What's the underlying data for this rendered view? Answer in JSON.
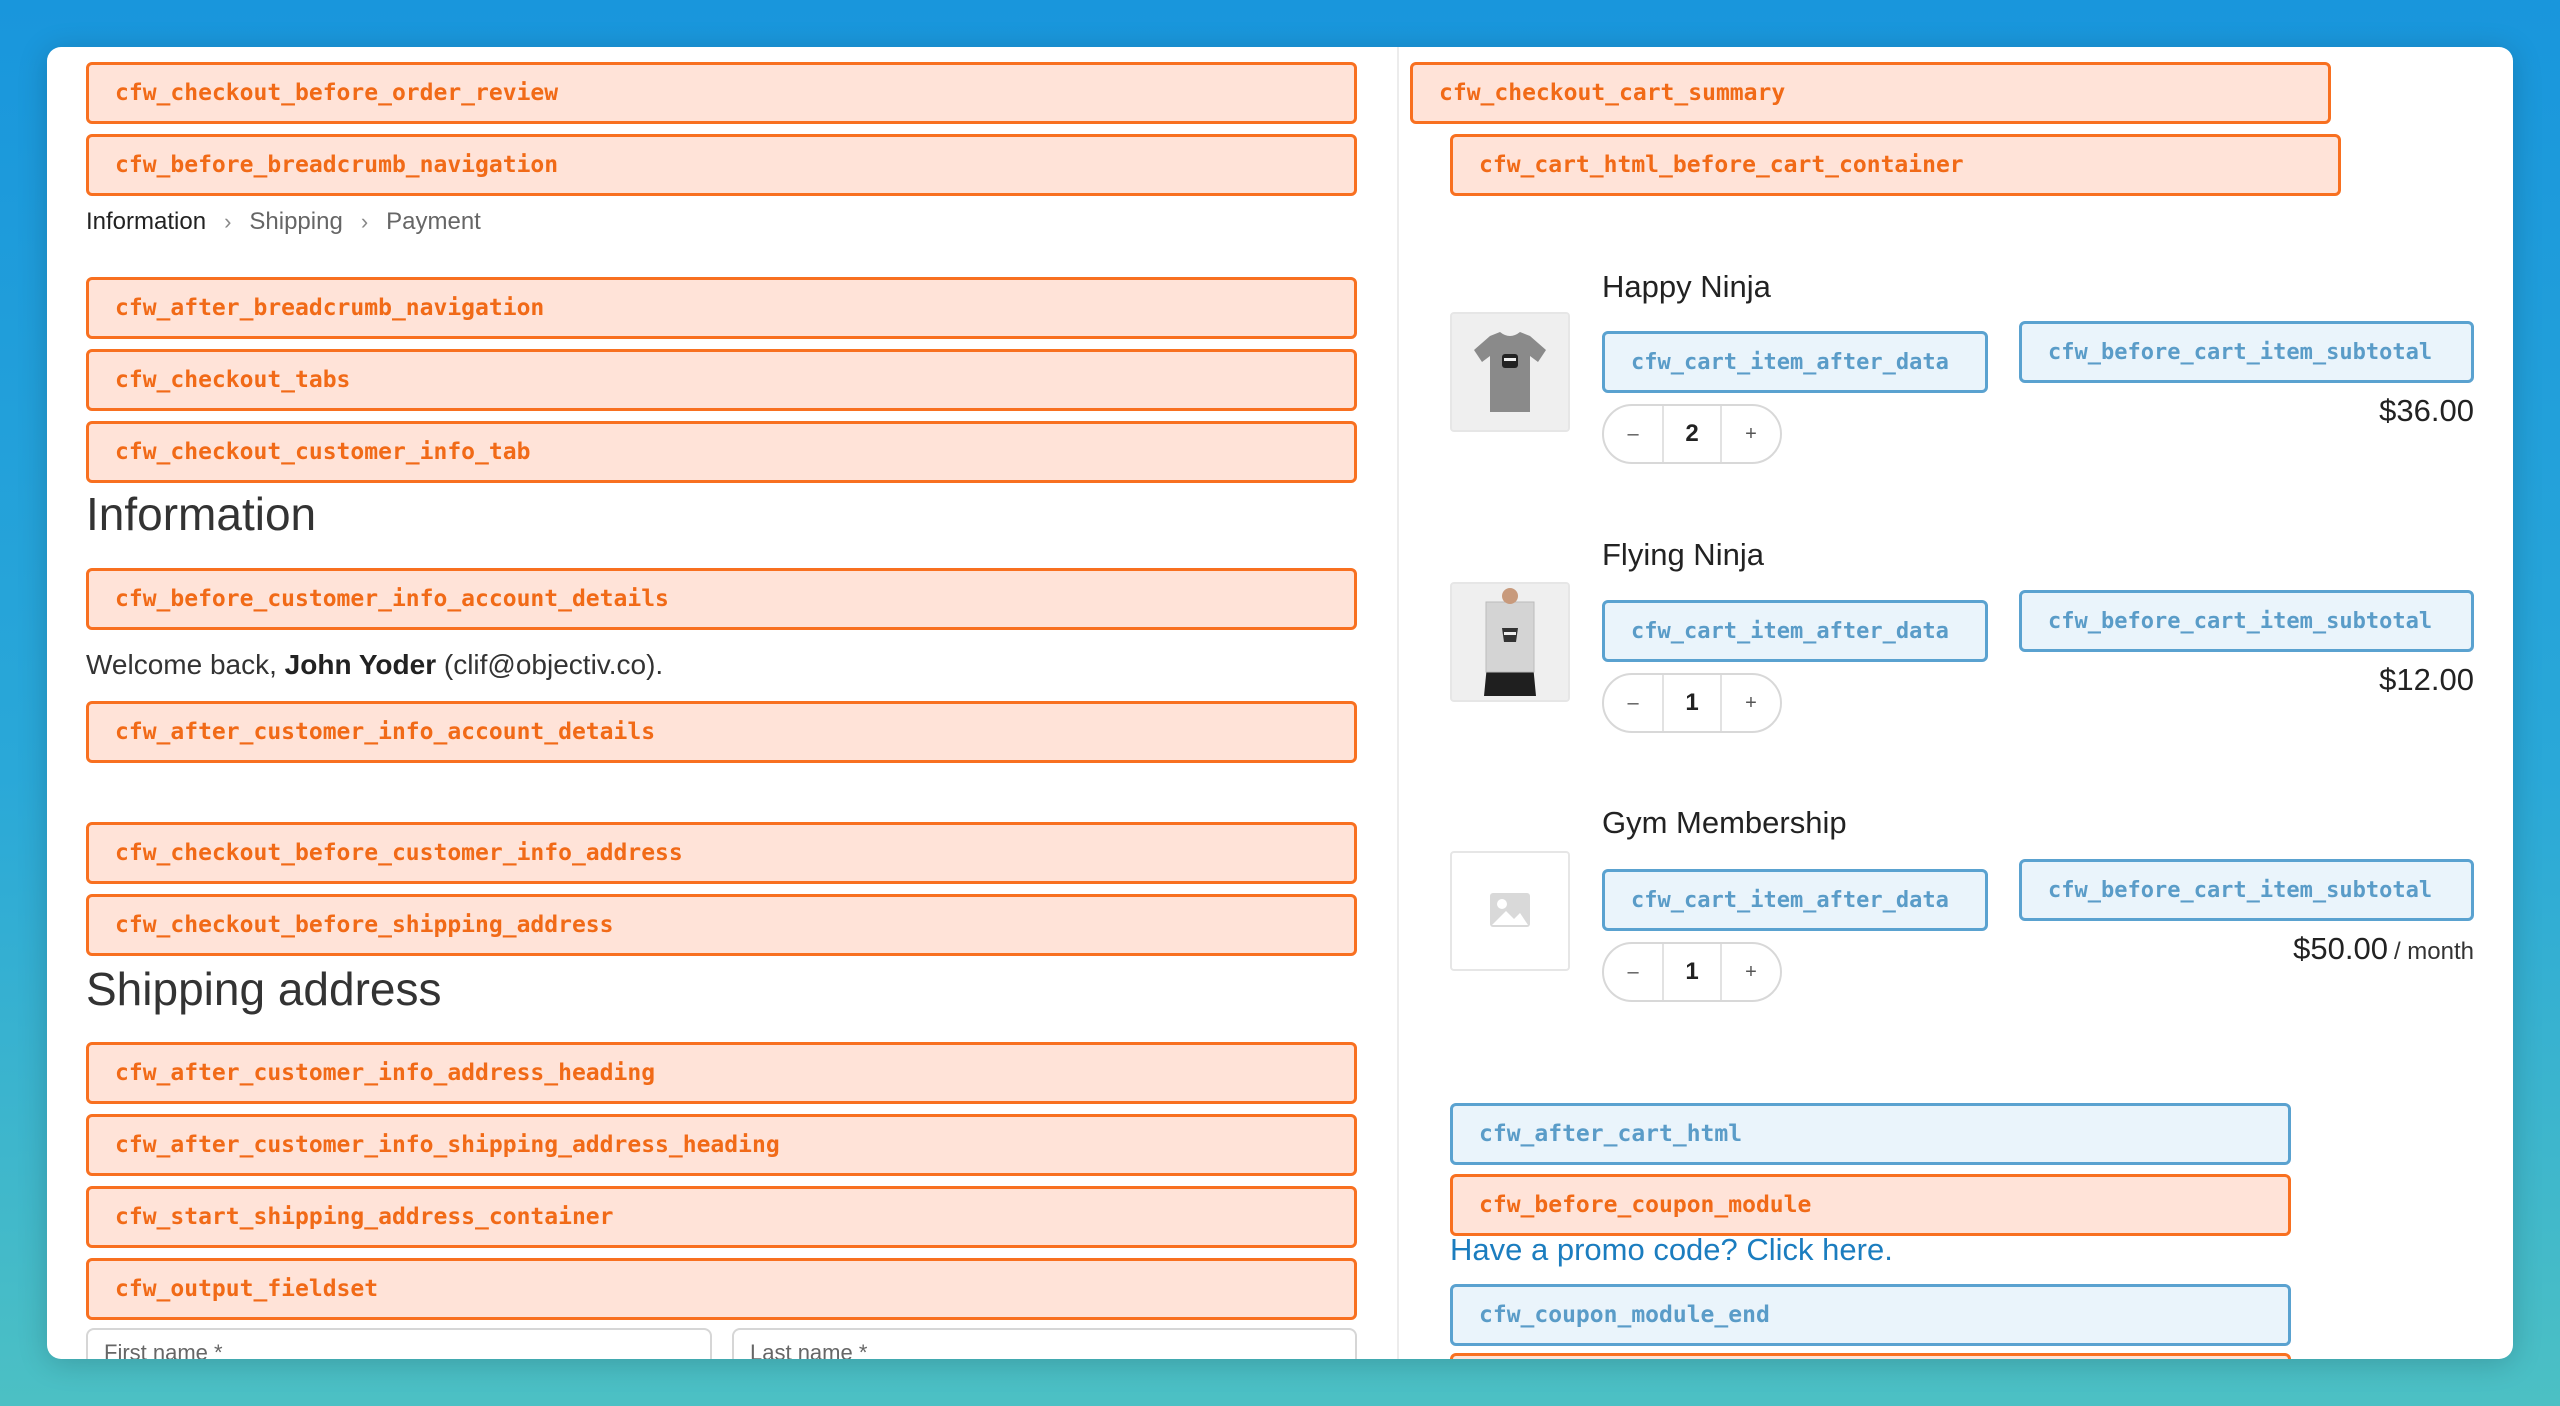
{
  "left_hooks": {
    "before_order_review": "cfw_checkout_before_order_review",
    "before_breadcrumb": "cfw_before_breadcrumb_navigation",
    "after_breadcrumb": "cfw_after_breadcrumb_navigation",
    "checkout_tabs": "cfw_checkout_tabs",
    "customer_info_tab": "cfw_checkout_customer_info_tab",
    "before_account_details": "cfw_before_customer_info_account_details",
    "after_account_details": "cfw_after_customer_info_account_details",
    "before_customer_info_address": "cfw_checkout_before_customer_info_address",
    "before_shipping_address": "cfw_checkout_before_shipping_address",
    "after_address_heading": "cfw_after_customer_info_address_heading",
    "after_shipping_address_heading": "cfw_after_customer_info_shipping_address_heading",
    "start_shipping_container": "cfw_start_shipping_address_container",
    "output_fieldset": "cfw_output_fieldset"
  },
  "breadcrumb": {
    "step1": "Information",
    "step2": "Shipping",
    "step3": "Payment",
    "separator": "›"
  },
  "headings": {
    "information": "Information",
    "shipping_address": "Shipping address"
  },
  "welcome": {
    "prefix": "Welcome back, ",
    "name": "John Yoder",
    "email": " (clif@objectiv.co)."
  },
  "fields": {
    "first_name": "First name *",
    "last_name": "Last name *"
  },
  "right_hooks": {
    "cart_summary": "cfw_checkout_cart_summary",
    "before_cart_container": "cfw_cart_html_before_cart_container",
    "after_cart_html": "cfw_after_cart_html",
    "before_coupon": "cfw_before_coupon_module",
    "coupon_end": "cfw_coupon_module_end"
  },
  "cart_items": [
    {
      "name": "Happy Ninja",
      "qty": "2",
      "price": "$36.00",
      "per": "",
      "hook_after_data": "cfw_cart_item_after_data",
      "hook_before_subtotal": "cfw_before_cart_item_subtotal",
      "icon": "tshirt-icon"
    },
    {
      "name": "Flying Ninja",
      "qty": "1",
      "price": "$12.00",
      "per": "",
      "hook_after_data": "cfw_cart_item_after_data",
      "hook_before_subtotal": "cfw_before_cart_item_subtotal",
      "icon": "poster-icon"
    },
    {
      "name": "Gym Membership",
      "qty": "1",
      "price": "$50.00",
      "per": "/ month",
      "hook_after_data": "cfw_cart_item_after_data",
      "hook_before_subtotal": "cfw_before_cart_item_subtotal",
      "icon": "image-placeholder-icon"
    }
  ],
  "stepper": {
    "minus": "–",
    "plus": "+"
  },
  "promo": "Have a promo code? Click here.",
  "colors": {
    "hook_orange": "#f87020",
    "hook_orange_bg": "#ffe3d8",
    "hook_blue": "#5aa2d0",
    "hook_blue_bg": "#eaf4fb",
    "link": "#1b7dbf"
  }
}
